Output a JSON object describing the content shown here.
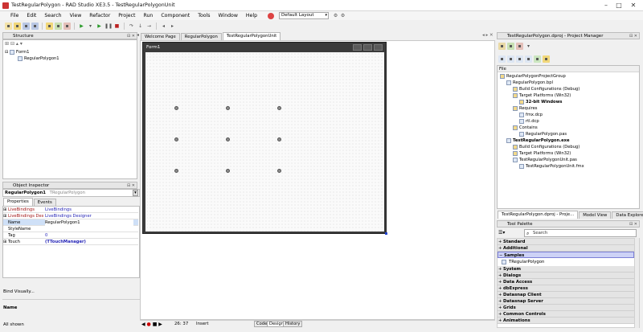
{
  "window": {
    "title": "TestRegularPolygon - RAD Studio XE3.5 - TestRegularPolygonUnit"
  },
  "menu": [
    "File",
    "Edit",
    "Search",
    "View",
    "Refactor",
    "Project",
    "Run",
    "Component",
    "Tools",
    "Window",
    "Help"
  ],
  "layout_select": "Default Layout",
  "structure": {
    "title": "Structure",
    "nodes": [
      "Form1",
      "RegularPolygon1"
    ]
  },
  "editor_tabs": [
    "Welcome Page",
    "RegularPolygon",
    "TestRegularPolygonUnit"
  ],
  "form": {
    "caption": "Form1"
  },
  "object_inspector": {
    "title": "Object Inspector",
    "selected_name": "RegularPolygon1",
    "selected_type": "TRegularPolygon",
    "tabs": [
      "Properties",
      "Events"
    ],
    "rows": [
      {
        "name": "LiveBindings",
        "value": "LiveBindings",
        "plus": "⊞"
      },
      {
        "name": "LiveBindings Designer",
        "value": "LiveBindings Designer",
        "plus": "⊞"
      },
      {
        "name": "Name",
        "value": "RegularPolygon1",
        "plus": ""
      },
      {
        "name": "StyleName",
        "value": "",
        "plus": ""
      },
      {
        "name": "Tag",
        "value": "0",
        "plus": ""
      },
      {
        "name": "Touch",
        "value": "(TTouchManager)",
        "plus": "⊞"
      }
    ],
    "bind_visually": "Bind Visually...",
    "desc_name": "Name",
    "all_shown": "All shown"
  },
  "project_manager": {
    "title": "TestRegularPolygon.dproj - Project Manager",
    "file_header": "File",
    "tree": [
      {
        "label": "RegularPolygonProjectGroup",
        "indent": 0,
        "bold": false
      },
      {
        "label": "RegularPolygon.bpl",
        "indent": 1,
        "bold": false
      },
      {
        "label": "Build Configurations (Debug)",
        "indent": 2,
        "bold": false
      },
      {
        "label": "Target Platforms (Win32)",
        "indent": 2,
        "bold": false
      },
      {
        "label": "32-bit Windows",
        "indent": 3,
        "bold": true
      },
      {
        "label": "Requires",
        "indent": 2,
        "bold": false
      },
      {
        "label": "fmx.dcp",
        "indent": 3,
        "bold": false
      },
      {
        "label": "rtl.dcp",
        "indent": 3,
        "bold": false
      },
      {
        "label": "Contains",
        "indent": 2,
        "bold": false
      },
      {
        "label": "RegularPolygon.pas",
        "indent": 3,
        "bold": false
      },
      {
        "label": "TestRegularPolygon.exe",
        "indent": 1,
        "bold": true
      },
      {
        "label": "Build Configurations (Debug)",
        "indent": 2,
        "bold": false
      },
      {
        "label": "Target Platforms (Win32)",
        "indent": 2,
        "bold": false
      },
      {
        "label": "TestRegularPolygonUnit.pas",
        "indent": 2,
        "bold": false
      },
      {
        "label": "TestRegularPolygonUnit.fmx",
        "indent": 3,
        "bold": false
      }
    ],
    "bottom_tabs": [
      "TestRegularPolygon.dproj - Proje...",
      "Model View",
      "Data Explorer"
    ]
  },
  "tool_palette": {
    "title": "Tool Palette",
    "search_placeholder": "Search",
    "categories": [
      "Standard",
      "Additional",
      "Samples",
      "System",
      "Dialogs",
      "Data Access",
      "dbExpress",
      "Datasnap Client",
      "Datasnap Server",
      "Grids",
      "Common Controls",
      "Animations"
    ],
    "sample_item": "TRegularPolygon"
  },
  "status": {
    "position": "26: 37",
    "mode": "Insert",
    "view_tabs": [
      "Code",
      "Design",
      "History"
    ]
  }
}
